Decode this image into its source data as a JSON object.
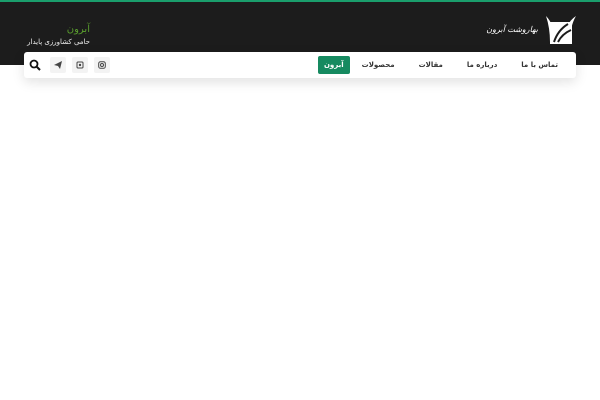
{
  "brand": {
    "title": "آبرون",
    "subtitle": "حامی کشاورزی پایدار",
    "logo_text": "بهاروشت آبرون"
  },
  "nav": {
    "items": [
      {
        "label": "آبرون",
        "active": true
      },
      {
        "label": "محصولات"
      },
      {
        "label": "مقالات"
      },
      {
        "label": "درباره ما"
      },
      {
        "label": "تماس با ما"
      }
    ]
  },
  "social": [
    "instagram-icon",
    "aparat-icon",
    "telegram-icon"
  ],
  "colors": {
    "accent": "#168a60",
    "header_bg": "#1c1c1c",
    "brand_green": "#5a9e2e"
  }
}
